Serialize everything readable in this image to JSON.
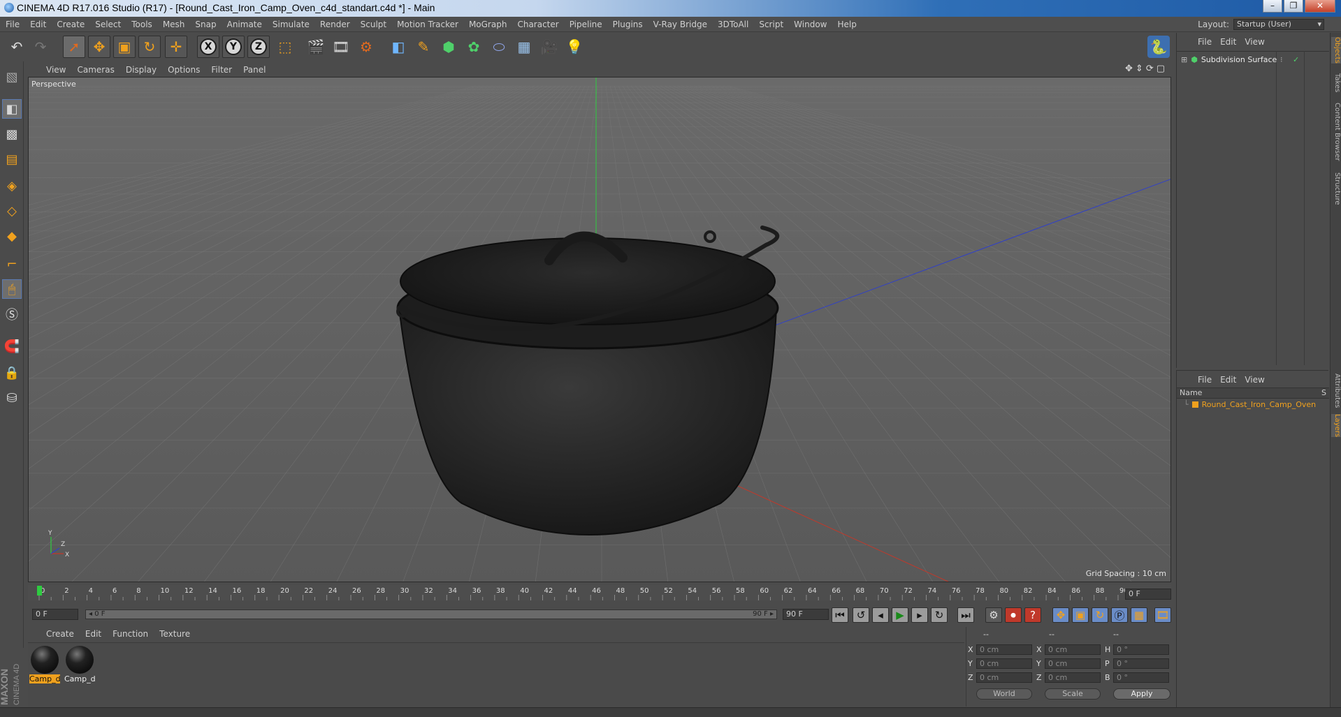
{
  "window": {
    "title": "CINEMA 4D R17.016 Studio (R17) - [Round_Cast_Iron_Camp_Oven_c4d_standart.c4d *] - Main",
    "controls": [
      "–",
      "❐",
      "✕"
    ]
  },
  "menubar": {
    "items": [
      "File",
      "Edit",
      "Create",
      "Select",
      "Tools",
      "Mesh",
      "Snap",
      "Animate",
      "Simulate",
      "Render",
      "Sculpt",
      "Motion Tracker",
      "MoGraph",
      "Character",
      "Pipeline",
      "Plugins",
      "V-Ray Bridge",
      "3DToAll",
      "Script",
      "Window",
      "Help"
    ],
    "layout_label": "Layout:",
    "layout_value": "Startup (User)"
  },
  "toolbar": {
    "axis_x": "X",
    "axis_y": "Y",
    "axis_z": "Z"
  },
  "viewport": {
    "menu": [
      "View",
      "Cameras",
      "Display",
      "Options",
      "Filter",
      "Panel"
    ],
    "label": "Perspective",
    "grid_spacing": "Grid Spacing : 10 cm",
    "axis_y_label": "Y",
    "axis_z_label": "Z",
    "axis_x_label": "X"
  },
  "timeline": {
    "ticks": [
      0,
      2,
      4,
      6,
      8,
      10,
      12,
      14,
      16,
      18,
      20,
      22,
      24,
      26,
      28,
      30,
      32,
      34,
      36,
      38,
      40,
      42,
      44,
      46,
      48,
      50,
      52,
      54,
      56,
      58,
      60,
      62,
      64,
      66,
      68,
      70,
      72,
      74,
      76,
      78,
      80,
      82,
      84,
      86,
      88,
      90
    ],
    "current_frame": "0 F",
    "range_max": 90
  },
  "playback": {
    "start_field": "0 F",
    "slider_start": "◂ 0 F",
    "slider_end": "90 F ▸",
    "end_field": "90 F"
  },
  "materials": {
    "menu": [
      "Create",
      "Edit",
      "Function",
      "Texture"
    ],
    "items": [
      {
        "label": "Camp_d",
        "selected": true
      },
      {
        "label": "Camp_d",
        "selected": false
      }
    ]
  },
  "coordinates": {
    "headers": [
      "--",
      "--",
      "--"
    ],
    "rows": [
      {
        "l1": "X",
        "v1": "0 cm",
        "l2": "X",
        "v2": "0 cm",
        "l3": "H",
        "v3": "0 °"
      },
      {
        "l1": "Y",
        "v1": "0 cm",
        "l2": "Y",
        "v2": "0 cm",
        "l3": "P",
        "v3": "0 °"
      },
      {
        "l1": "Z",
        "v1": "0 cm",
        "l2": "Z",
        "v2": "0 cm",
        "l3": "B",
        "v3": "0 °"
      }
    ],
    "world": "World",
    "scale": "Scale",
    "apply": "Apply"
  },
  "objects": {
    "menu": [
      "File",
      "Edit",
      "View"
    ],
    "items": [
      "Subdivision Surface"
    ]
  },
  "layers": {
    "menu": [
      "File",
      "Edit",
      "View"
    ],
    "col_name": "Name",
    "col_s": "S",
    "items": [
      "Round_Cast_Iron_Camp_Oven"
    ]
  },
  "side_tabs": [
    "Objects",
    "Takes",
    "Content Browser",
    "Structure",
    "Attributes",
    "Layers"
  ],
  "logo": {
    "maxon": "MAXON",
    "c4d": "CINEMA 4D"
  },
  "colors": {
    "accent": "#f0a11e",
    "panel": "#4b4b4b",
    "viewport": "#5d5d5d",
    "x_axis": "#c0392b",
    "y_axis": "#27ae60",
    "z_axis": "#2c3fbf"
  }
}
